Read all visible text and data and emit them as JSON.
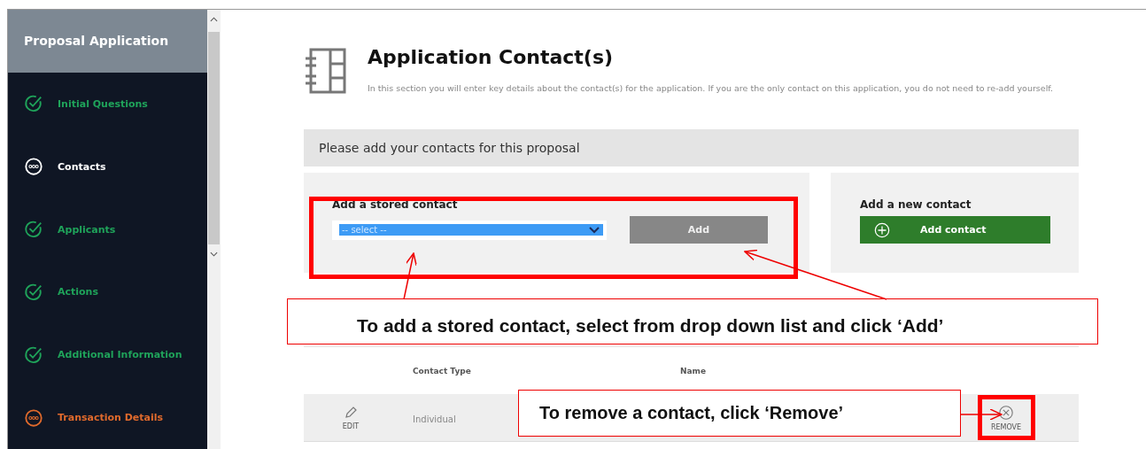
{
  "sidebar": {
    "title": "Proposal Application",
    "items": [
      {
        "label": "Initial Questions",
        "kind": "complete"
      },
      {
        "label": "Contacts",
        "kind": "current"
      },
      {
        "label": "Applicants",
        "kind": "complete"
      },
      {
        "label": "Actions",
        "kind": "complete"
      },
      {
        "label": "Additional Information",
        "kind": "complete"
      },
      {
        "label": "Transaction Details",
        "kind": "pending"
      }
    ]
  },
  "header": {
    "title": "Application Contact(s)",
    "description": "In this section you will enter key details about the contact(s) for the application. If you are the only contact on this application, you do not need to re-add yourself."
  },
  "section_title": "Please add your contacts for this proposal",
  "stored_contact": {
    "label": "Add a stored contact",
    "select_value": "-- select --",
    "button": "Add"
  },
  "new_contact": {
    "label": "Add a new contact",
    "button": "Add contact"
  },
  "table": {
    "columns": [
      "Contact Type",
      "Name"
    ],
    "rows": [
      {
        "edit": "EDIT",
        "contact_type": "Individual",
        "remove": "REMOVE"
      }
    ]
  },
  "annotations": [
    "To add a stored contact, select from drop down list and click ‘Add’",
    "To remove a contact, click ‘Remove’"
  ]
}
